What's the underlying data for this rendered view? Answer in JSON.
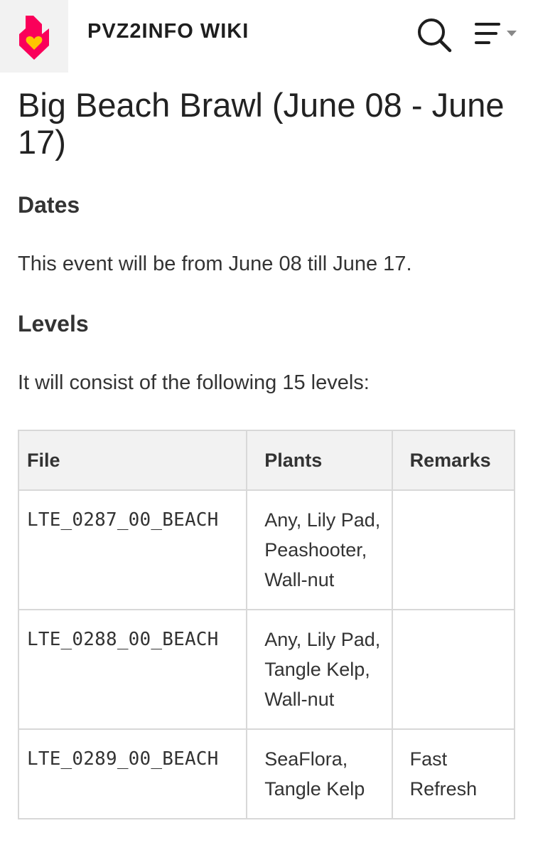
{
  "header": {
    "site_name": "PVZ2INFO WIKI",
    "logo_icon": "fandom-heart-logo-icon",
    "search_icon": "search-icon",
    "menu_icon": "menu-icon",
    "accent_color": "#fa005a",
    "logo_accent_color": "#ffc500"
  },
  "page": {
    "title": "Big Beach Brawl (June 08 - June 17)",
    "sections": {
      "dates": {
        "heading": "Dates",
        "text": "This event will be from June 08 till June 17."
      },
      "levels": {
        "heading": "Levels",
        "text": "It will consist of the following 15 levels:"
      }
    }
  },
  "table": {
    "headers": {
      "file": "File",
      "plants": "Plants",
      "remarks": "Remarks"
    },
    "rows": [
      {
        "file": "LTE_0287_00_BEACH",
        "plants": "Any, Lily Pad, Peashooter, Wall-nut",
        "remarks": ""
      },
      {
        "file": "LTE_0288_00_BEACH",
        "plants": "Any, Lily Pad, Tangle Kelp, Wall-nut",
        "remarks": ""
      },
      {
        "file": "LTE_0289_00_BEACH",
        "plants": "SeaFlora, Tangle Kelp",
        "remarks": "Fast Refresh"
      }
    ]
  }
}
